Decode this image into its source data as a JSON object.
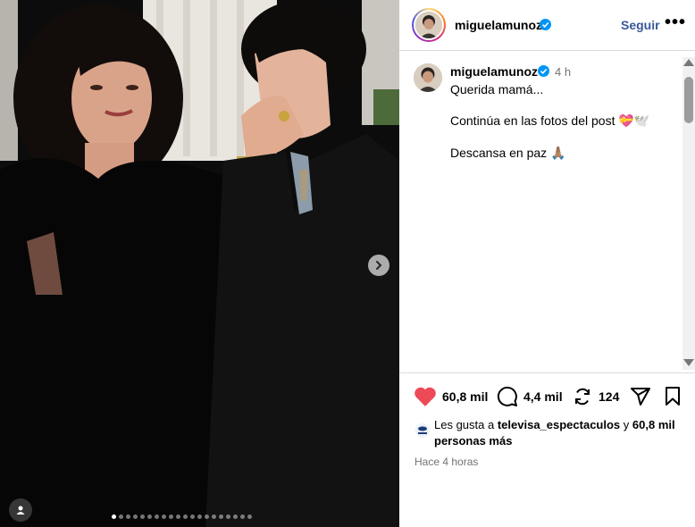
{
  "post": {
    "username": "miguelamunoz",
    "follow_label": "Seguir",
    "more_label": "•••"
  },
  "caption": {
    "username": "miguelamunoz",
    "time": "4 h",
    "line1": "Querida mamá...",
    "line2": "Continúa en las fotos del post 💝🕊️",
    "line3": "Descansa en paz 🙏🏽"
  },
  "actions": {
    "likes": "60,8 mil",
    "comments": "4,4 mil",
    "reposts": "124"
  },
  "likes_summary": {
    "prefix": "Les gusta a",
    "account": "televisa_espectaculos",
    "joiner": "y",
    "count": "60,8 mil",
    "suffix": "personas más"
  },
  "posted_ago": "Hace 4 horas",
  "carousel": {
    "slides": 20,
    "active_index": 0
  },
  "colors": {
    "like": "#ed4956",
    "follow": "#385898",
    "verified": "#0095f6"
  }
}
